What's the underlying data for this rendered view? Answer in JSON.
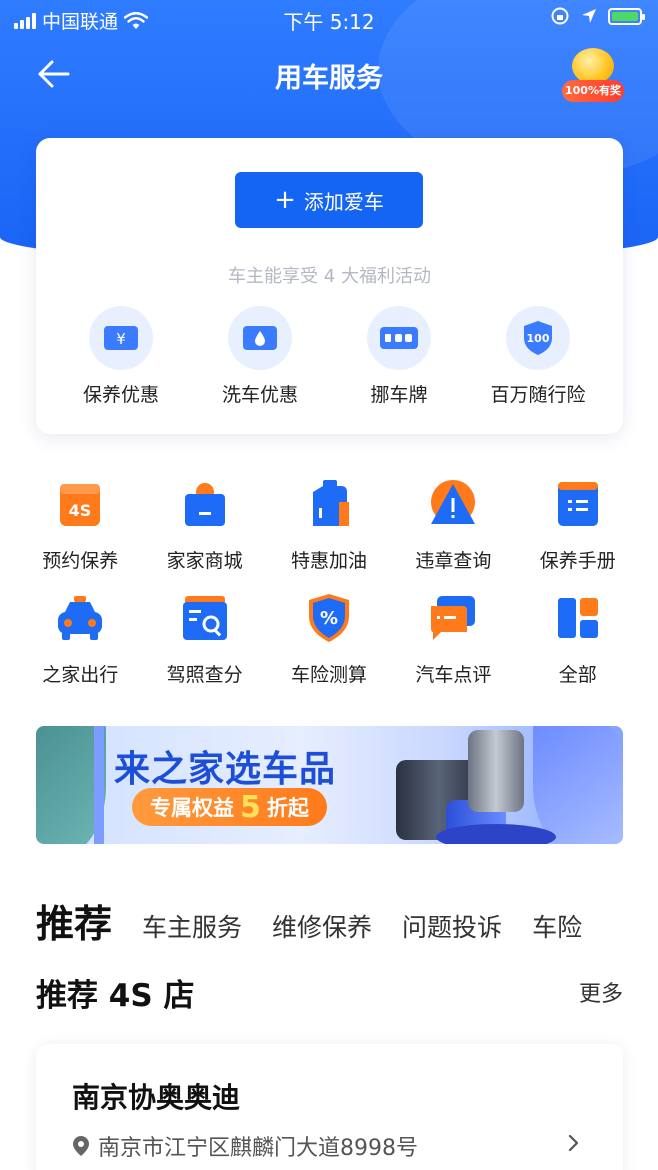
{
  "status_bar": {
    "carrier": "中国联通",
    "time": "下午 5:12"
  },
  "nav": {
    "title": "用车服务",
    "award_label": "100%有奖"
  },
  "card": {
    "add_car_label": "添加爱车",
    "subtitle": "车主能享受 4 大福利活动",
    "benefits": [
      {
        "label": "保养优惠",
        "icon": "yen-ticket-icon"
      },
      {
        "label": "洗车优惠",
        "icon": "water-drop-ticket-icon"
      },
      {
        "label": "挪车牌",
        "icon": "phone-plate-icon"
      },
      {
        "label": "百万随行险",
        "icon": "shield-100-icon"
      }
    ]
  },
  "services": [
    {
      "label": "预约保养",
      "icon": "4s-calendar-icon"
    },
    {
      "label": "家家商城",
      "icon": "shopping-bag-icon"
    },
    {
      "label": "特惠加油",
      "icon": "oil-can-icon"
    },
    {
      "label": "违章查询",
      "icon": "warning-triangle-icon"
    },
    {
      "label": "保养手册",
      "icon": "manual-book-icon"
    },
    {
      "label": "之家出行",
      "icon": "taxi-icon"
    },
    {
      "label": "驾照查分",
      "icon": "license-search-icon"
    },
    {
      "label": "车险测算",
      "icon": "percent-shield-icon"
    },
    {
      "label": "汽车点评",
      "icon": "chat-bubble-icon"
    },
    {
      "label": "全部",
      "icon": "grid-all-icon"
    }
  ],
  "banner": {
    "title": "来之家选车品",
    "pill_prefix": "专属权益",
    "pill_number": "5",
    "pill_suffix": "折起"
  },
  "tabs": [
    {
      "label": "推荐",
      "active": true
    },
    {
      "label": "车主服务"
    },
    {
      "label": "维修保养"
    },
    {
      "label": "问题投诉"
    },
    {
      "label": "车险"
    }
  ],
  "section": {
    "title": "推荐 4S 店",
    "more": "更多"
  },
  "store": {
    "name": "南京协奥奥迪",
    "address": "南京市江宁区麒麟门大道8998号"
  },
  "colors": {
    "primary": "#1565f5",
    "accent_orange": "#ff7a1a",
    "icon_bg": "#e8f0ff"
  }
}
